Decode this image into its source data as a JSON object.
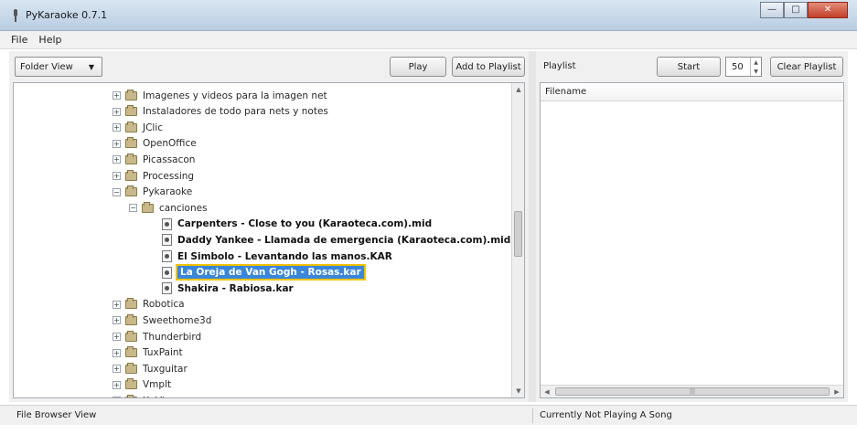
{
  "window": {
    "title": "PyKaraoke 0.7.1",
    "minimize_glyph": "—",
    "maximize_glyph": "□",
    "close_glyph": "✕"
  },
  "menu": [
    "File",
    "Help"
  ],
  "left_pane": {
    "view_select": "Folder View",
    "play_label": "Play",
    "add_to_playlist_label": "Add to Playlist"
  },
  "tree": [
    {
      "label": "Imagenes y videos para la imagen net",
      "kind": "folder",
      "expander": "+"
    },
    {
      "label": "Instaladores de todo para nets y notes",
      "kind": "folder",
      "expander": "+"
    },
    {
      "label": "JClic",
      "kind": "folder",
      "expander": "+"
    },
    {
      "label": "OpenOffice",
      "kind": "folder",
      "expander": "+"
    },
    {
      "label": "Picassacon",
      "kind": "folder",
      "expander": "+"
    },
    {
      "label": "Processing",
      "kind": "folder",
      "expander": "+"
    },
    {
      "label": "Pykaraoke",
      "kind": "folder",
      "expander": "−"
    },
    {
      "label": "canciones",
      "kind": "folder",
      "expander": "−"
    },
    {
      "label": "Carpenters - Close to you (Karaoteca.com).mid",
      "kind": "file"
    },
    {
      "label": "Daddy Yankee - Llamada de emergencia (Karaoteca.com).mid",
      "kind": "file"
    },
    {
      "label": "El Simbolo - Levantando las manos.KAR",
      "kind": "file"
    },
    {
      "label": "La Oreja de Van Gogh - Rosas.kar",
      "kind": "file",
      "selected": true
    },
    {
      "label": "Shakira - Rabiosa.kar",
      "kind": "file"
    },
    {
      "label": "Robotica",
      "kind": "folder",
      "expander": "+"
    },
    {
      "label": "Sweethome3d",
      "kind": "folder",
      "expander": "+"
    },
    {
      "label": "Thunderbird",
      "kind": "folder",
      "expander": "+"
    },
    {
      "label": "TuxPaint",
      "kind": "folder",
      "expander": "+"
    },
    {
      "label": "Tuxguitar",
      "kind": "folder",
      "expander": "+"
    },
    {
      "label": "Vmplt",
      "kind": "folder",
      "expander": "+"
    },
    {
      "label": "XnView",
      "kind": "folder",
      "expander": "+"
    }
  ],
  "right_pane": {
    "playlist_label": "Playlist",
    "start_label": "Start",
    "spin_value": "50",
    "clear_playlist_label": "Clear Playlist",
    "filename_header": "Filename",
    "hscroll_grip": "|||"
  },
  "status": {
    "left": "File Browser View",
    "right": "Currently Not Playing A Song"
  },
  "colors": {
    "selection": "#3a86d8",
    "selection_outline": "#f2c200",
    "titlebar": "#c9d9ea"
  }
}
